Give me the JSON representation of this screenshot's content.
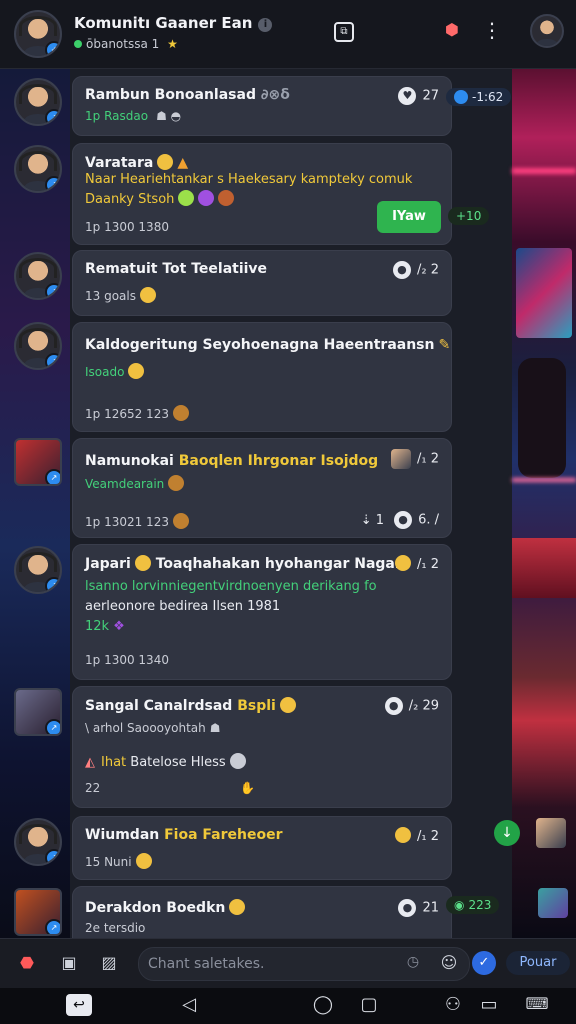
{
  "header": {
    "title": "Komunitı Gaaner Ean",
    "subtitle": "ōbanotssa 1",
    "icons": [
      "info-icon",
      "copy-icon",
      "settings-gem-icon",
      "more-vert-icon",
      "profile-avatar"
    ]
  },
  "messages": [
    {
      "name": "Rambun Bonoanlasad",
      "name_suffix": " ∂⊗δ",
      "sub": "1p Rasdao",
      "right_num": "27",
      "chip": "-1:62"
    },
    {
      "name": "Varatara",
      "body1": "Naar Heariehtankar s Haekesary kampteky comuk",
      "body2": "Daanky Stsoh",
      "meta": "1p 1300 1380",
      "button": "IYaw",
      "chip": "+10"
    },
    {
      "name": "Rematuit Tot Teelatiive",
      "sub": "13 goals",
      "right_num": "2"
    },
    {
      "name": "Kaldogeritung Seyohoenagna Haeentraansn",
      "sub": "Isoado",
      "meta": "1p 12652 123"
    },
    {
      "name": "Namunokai",
      "name_hl": "Baoqlen Ihrgonar Isojdog",
      "sub": "Veamdearain",
      "meta": "1p 13021 123",
      "right_num": "2",
      "right2": "6."
    },
    {
      "name": "Japari",
      "name_rest": "Toaqhahakan hyohangar Nagan",
      "body1": "lsanno lorvinniegentvirdnoenyen derikang fo",
      "body2": "aerleonore bedirea Ilsen 1981",
      "body3": "12k",
      "meta": "1p 1300 1340",
      "right_num": "2"
    },
    {
      "name": "Sangal Canalrdsad",
      "name_hl": "Bspli",
      "sub": "\\ arhol Saoooyohtah",
      "body1": "Ihat",
      "body1_rest": " Batelose Hless",
      "meta": "22",
      "right_num": "29"
    },
    {
      "name": "Wiumdan",
      "name_hl": "Fioa Fareheoer",
      "sub": "15 Nuni",
      "right_num": "2"
    },
    {
      "name": "Derakdon Boedkn",
      "sub": "2e tersdio",
      "right_num": "21",
      "chip": "223"
    }
  ],
  "composer": {
    "placeholder": "Chant saletakes.",
    "send_label": "Pouar"
  },
  "colors": {
    "accent_yellow": "#f0c93a",
    "accent_green": "#43d07a",
    "bubble": "#303441",
    "link_blue": "#2d8cf0"
  }
}
